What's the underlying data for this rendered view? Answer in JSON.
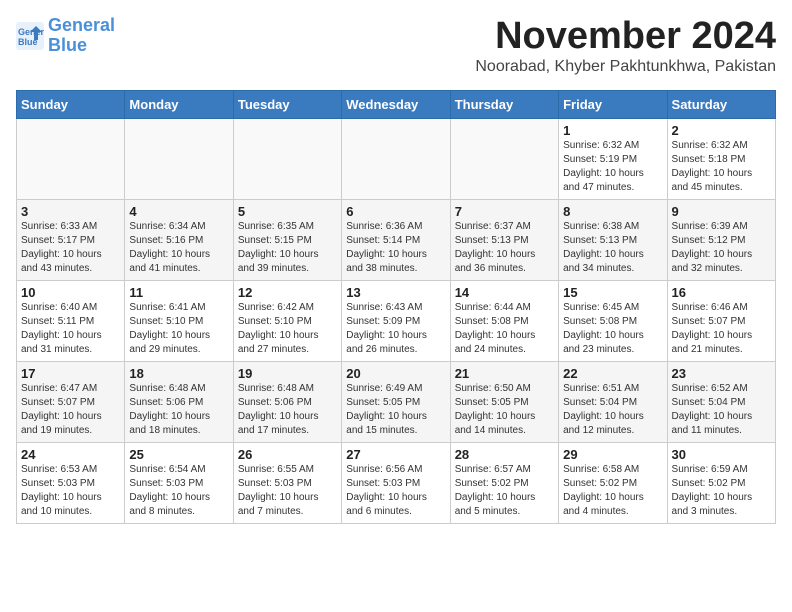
{
  "header": {
    "logo_line1": "General",
    "logo_line2": "Blue",
    "month_title": "November 2024",
    "location": "Noorabad, Khyber Pakhtunkhwa, Pakistan"
  },
  "weekdays": [
    "Sunday",
    "Monday",
    "Tuesday",
    "Wednesday",
    "Thursday",
    "Friday",
    "Saturday"
  ],
  "weeks": [
    [
      {
        "day": "",
        "info": ""
      },
      {
        "day": "",
        "info": ""
      },
      {
        "day": "",
        "info": ""
      },
      {
        "day": "",
        "info": ""
      },
      {
        "day": "",
        "info": ""
      },
      {
        "day": "1",
        "info": "Sunrise: 6:32 AM\nSunset: 5:19 PM\nDaylight: 10 hours\nand 47 minutes."
      },
      {
        "day": "2",
        "info": "Sunrise: 6:32 AM\nSunset: 5:18 PM\nDaylight: 10 hours\nand 45 minutes."
      }
    ],
    [
      {
        "day": "3",
        "info": "Sunrise: 6:33 AM\nSunset: 5:17 PM\nDaylight: 10 hours\nand 43 minutes."
      },
      {
        "day": "4",
        "info": "Sunrise: 6:34 AM\nSunset: 5:16 PM\nDaylight: 10 hours\nand 41 minutes."
      },
      {
        "day": "5",
        "info": "Sunrise: 6:35 AM\nSunset: 5:15 PM\nDaylight: 10 hours\nand 39 minutes."
      },
      {
        "day": "6",
        "info": "Sunrise: 6:36 AM\nSunset: 5:14 PM\nDaylight: 10 hours\nand 38 minutes."
      },
      {
        "day": "7",
        "info": "Sunrise: 6:37 AM\nSunset: 5:13 PM\nDaylight: 10 hours\nand 36 minutes."
      },
      {
        "day": "8",
        "info": "Sunrise: 6:38 AM\nSunset: 5:13 PM\nDaylight: 10 hours\nand 34 minutes."
      },
      {
        "day": "9",
        "info": "Sunrise: 6:39 AM\nSunset: 5:12 PM\nDaylight: 10 hours\nand 32 minutes."
      }
    ],
    [
      {
        "day": "10",
        "info": "Sunrise: 6:40 AM\nSunset: 5:11 PM\nDaylight: 10 hours\nand 31 minutes."
      },
      {
        "day": "11",
        "info": "Sunrise: 6:41 AM\nSunset: 5:10 PM\nDaylight: 10 hours\nand 29 minutes."
      },
      {
        "day": "12",
        "info": "Sunrise: 6:42 AM\nSunset: 5:10 PM\nDaylight: 10 hours\nand 27 minutes."
      },
      {
        "day": "13",
        "info": "Sunrise: 6:43 AM\nSunset: 5:09 PM\nDaylight: 10 hours\nand 26 minutes."
      },
      {
        "day": "14",
        "info": "Sunrise: 6:44 AM\nSunset: 5:08 PM\nDaylight: 10 hours\nand 24 minutes."
      },
      {
        "day": "15",
        "info": "Sunrise: 6:45 AM\nSunset: 5:08 PM\nDaylight: 10 hours\nand 23 minutes."
      },
      {
        "day": "16",
        "info": "Sunrise: 6:46 AM\nSunset: 5:07 PM\nDaylight: 10 hours\nand 21 minutes."
      }
    ],
    [
      {
        "day": "17",
        "info": "Sunrise: 6:47 AM\nSunset: 5:07 PM\nDaylight: 10 hours\nand 19 minutes."
      },
      {
        "day": "18",
        "info": "Sunrise: 6:48 AM\nSunset: 5:06 PM\nDaylight: 10 hours\nand 18 minutes."
      },
      {
        "day": "19",
        "info": "Sunrise: 6:48 AM\nSunset: 5:06 PM\nDaylight: 10 hours\nand 17 minutes."
      },
      {
        "day": "20",
        "info": "Sunrise: 6:49 AM\nSunset: 5:05 PM\nDaylight: 10 hours\nand 15 minutes."
      },
      {
        "day": "21",
        "info": "Sunrise: 6:50 AM\nSunset: 5:05 PM\nDaylight: 10 hours\nand 14 minutes."
      },
      {
        "day": "22",
        "info": "Sunrise: 6:51 AM\nSunset: 5:04 PM\nDaylight: 10 hours\nand 12 minutes."
      },
      {
        "day": "23",
        "info": "Sunrise: 6:52 AM\nSunset: 5:04 PM\nDaylight: 10 hours\nand 11 minutes."
      }
    ],
    [
      {
        "day": "24",
        "info": "Sunrise: 6:53 AM\nSunset: 5:03 PM\nDaylight: 10 hours\nand 10 minutes."
      },
      {
        "day": "25",
        "info": "Sunrise: 6:54 AM\nSunset: 5:03 PM\nDaylight: 10 hours\nand 8 minutes."
      },
      {
        "day": "26",
        "info": "Sunrise: 6:55 AM\nSunset: 5:03 PM\nDaylight: 10 hours\nand 7 minutes."
      },
      {
        "day": "27",
        "info": "Sunrise: 6:56 AM\nSunset: 5:03 PM\nDaylight: 10 hours\nand 6 minutes."
      },
      {
        "day": "28",
        "info": "Sunrise: 6:57 AM\nSunset: 5:02 PM\nDaylight: 10 hours\nand 5 minutes."
      },
      {
        "day": "29",
        "info": "Sunrise: 6:58 AM\nSunset: 5:02 PM\nDaylight: 10 hours\nand 4 minutes."
      },
      {
        "day": "30",
        "info": "Sunrise: 6:59 AM\nSunset: 5:02 PM\nDaylight: 10 hours\nand 3 minutes."
      }
    ]
  ]
}
